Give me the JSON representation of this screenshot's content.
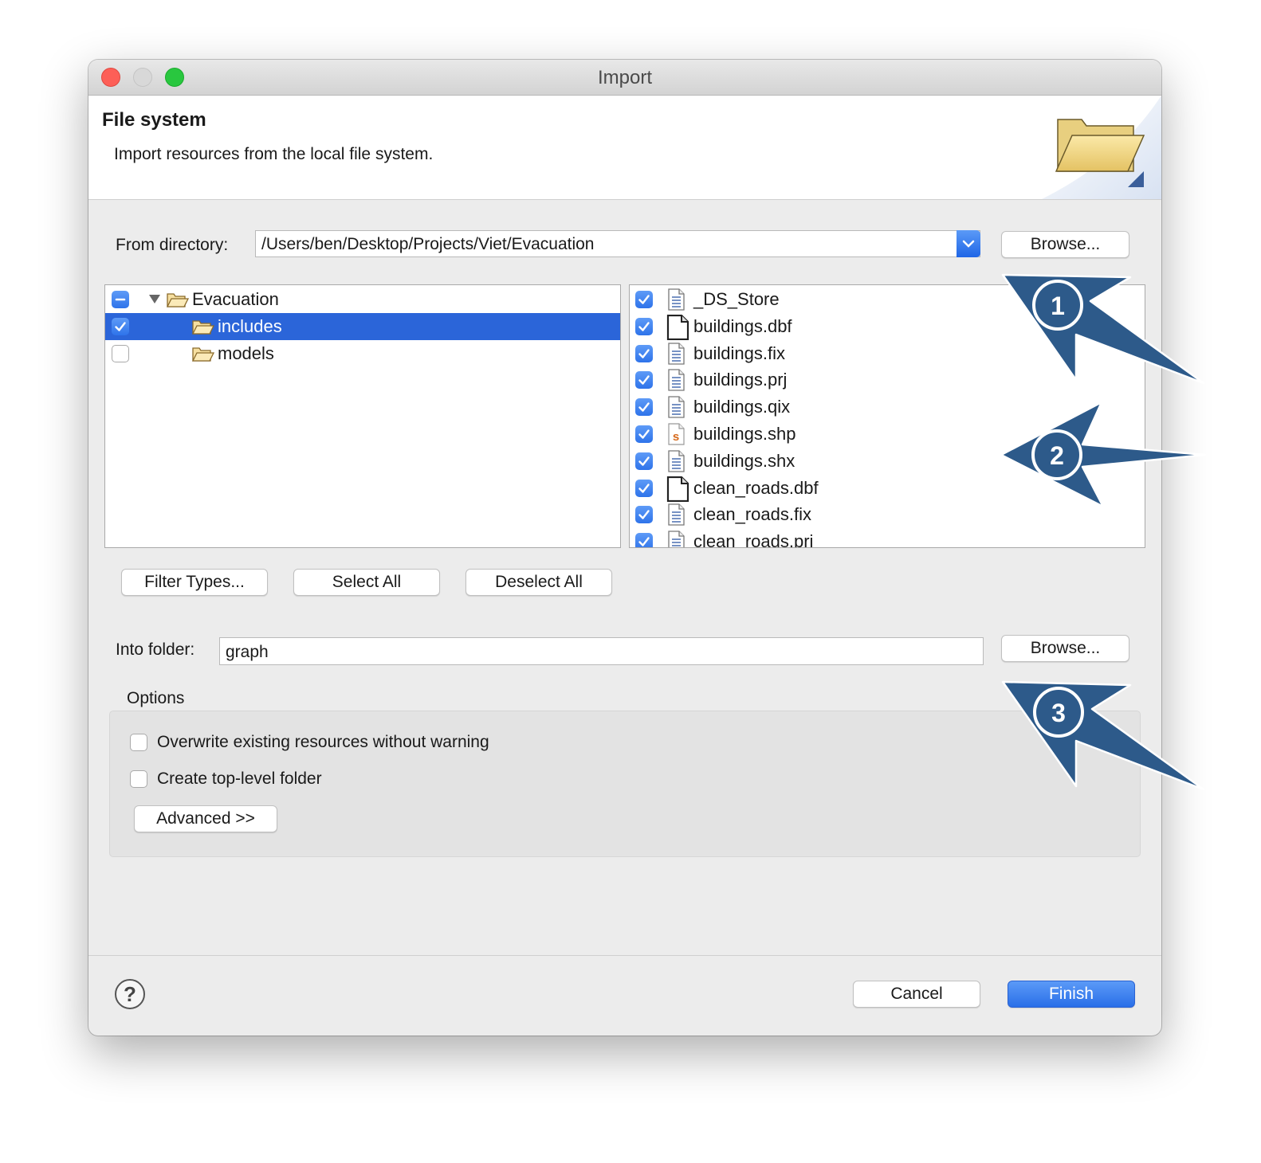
{
  "window": {
    "title": "Import"
  },
  "banner": {
    "title": "File system",
    "description": "Import resources from the local file system."
  },
  "from_directory": {
    "label": "From directory:",
    "value": "/Users/ben/Desktop/Projects/Viet/Evacuation",
    "browse_label": "Browse..."
  },
  "folder_tree": [
    {
      "label": "Evacuation",
      "check": "partial",
      "expanded": true,
      "selected": false
    },
    {
      "label": "includes",
      "check": "checked",
      "selected": true
    },
    {
      "label": "models",
      "check": "unchecked",
      "selected": false
    }
  ],
  "file_list": [
    {
      "name": "_DS_Store",
      "icon": "text-file-icon",
      "checked": true
    },
    {
      "name": "buildings.dbf",
      "icon": "blank-file-icon",
      "checked": true
    },
    {
      "name": "buildings.fix",
      "icon": "text-file-icon",
      "checked": true
    },
    {
      "name": "buildings.prj",
      "icon": "text-file-icon",
      "checked": true
    },
    {
      "name": "buildings.qix",
      "icon": "text-file-icon",
      "checked": true
    },
    {
      "name": "buildings.shp",
      "icon": "s-file-icon",
      "checked": true
    },
    {
      "name": "buildings.shx",
      "icon": "text-file-icon",
      "checked": true
    },
    {
      "name": "clean_roads.dbf",
      "icon": "blank-file-icon",
      "checked": true
    },
    {
      "name": "clean_roads.fix",
      "icon": "text-file-icon",
      "checked": true
    },
    {
      "name": "clean_roads.pri",
      "icon": "text-file-icon",
      "checked": true
    }
  ],
  "selection_buttons": {
    "filter_types": "Filter Types...",
    "select_all": "Select All",
    "deselect_all": "Deselect All"
  },
  "into_folder": {
    "label": "Into folder:",
    "value": "graph",
    "browse_label": "Browse..."
  },
  "options": {
    "title": "Options",
    "overwrite": {
      "label": "Overwrite existing resources without warning",
      "checked": false
    },
    "create_top_level": {
      "label": "Create top-level folder",
      "checked": false
    },
    "advanced_label": "Advanced >>"
  },
  "footer": {
    "cancel_label": "Cancel",
    "finish_label": "Finish"
  },
  "annotations": [
    "1",
    "2",
    "3"
  ],
  "colors": {
    "accent": "#2b65d9",
    "annotation_fill": "#2d5a8a"
  }
}
